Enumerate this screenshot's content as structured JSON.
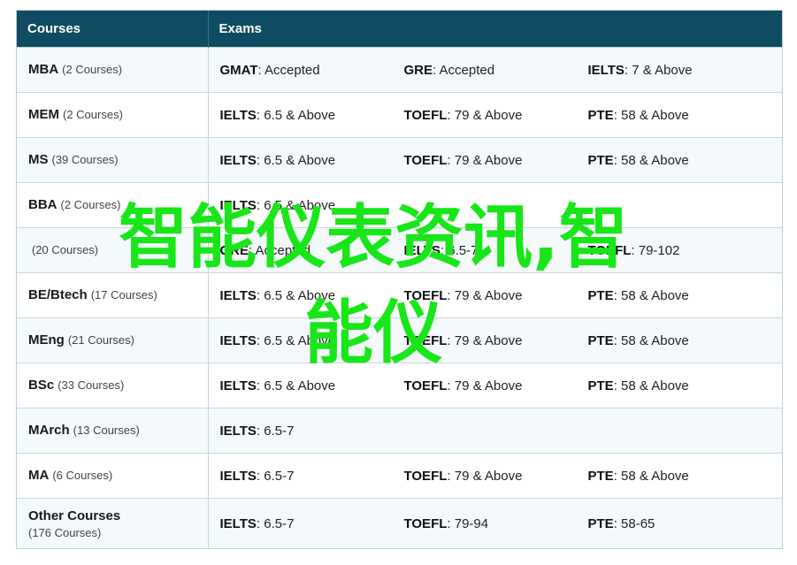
{
  "header": {
    "courses": "Courses",
    "exams": "Exams"
  },
  "rows": [
    {
      "name": "MBA",
      "count": "(2 Courses)",
      "exams": [
        {
          "name": "GMAT",
          "value": ": Accepted"
        },
        {
          "name": "GRE",
          "value": ": Accepted"
        },
        {
          "name": "IELTS",
          "value": ": 7 & Above"
        }
      ]
    },
    {
      "name": "MEM",
      "count": "(2 Courses)",
      "exams": [
        {
          "name": "IELTS",
          "value": ": 6.5 & Above"
        },
        {
          "name": "TOEFL",
          "value": ": 79 & Above"
        },
        {
          "name": "PTE",
          "value": ": 58 & Above"
        }
      ]
    },
    {
      "name": "MS",
      "count": "(39 Courses)",
      "exams": [
        {
          "name": "IELTS",
          "value": ": 6.5 & Above"
        },
        {
          "name": "TOEFL",
          "value": ": 79 & Above"
        },
        {
          "name": "PTE",
          "value": ": 58 & Above"
        }
      ]
    },
    {
      "name": "BBA",
      "count": "(2 Courses)",
      "exams": [
        {
          "name": "IELTS",
          "value": ": 6.5 & Above"
        },
        {
          "name": "",
          "value": ""
        },
        {
          "name": "",
          "value": ""
        }
      ]
    },
    {
      "name": "",
      "count": "(20 Courses)",
      "exams": [
        {
          "name": "GRE",
          "value": ": Accepted"
        },
        {
          "name": "IELTS",
          "value": ": 6.5-7"
        },
        {
          "name": "TOEFL",
          "value": ": 79-102"
        }
      ]
    },
    {
      "name": "BE/Btech",
      "count": "(17 Courses)",
      "exams": [
        {
          "name": "IELTS",
          "value": ": 6.5 & Above"
        },
        {
          "name": "TOEFL",
          "value": ": 79 & Above"
        },
        {
          "name": "PTE",
          "value": ": 58 & Above"
        }
      ]
    },
    {
      "name": "MEng",
      "count": "(21 Courses)",
      "exams": [
        {
          "name": "IELTS",
          "value": ": 6.5 & Above"
        },
        {
          "name": "TOEFL",
          "value": ": 79 & Above"
        },
        {
          "name": "PTE",
          "value": ": 58 & Above"
        }
      ]
    },
    {
      "name": "BSc",
      "count": "(33 Courses)",
      "exams": [
        {
          "name": "IELTS",
          "value": ": 6.5 & Above"
        },
        {
          "name": "TOEFL",
          "value": ": 79 & Above"
        },
        {
          "name": "PTE",
          "value": ": 58 & Above"
        }
      ]
    },
    {
      "name": "MArch",
      "count": "(13 Courses)",
      "exams": [
        {
          "name": "IELTS",
          "value": ": 6.5-7"
        },
        {
          "name": "",
          "value": ""
        },
        {
          "name": "",
          "value": ""
        }
      ]
    },
    {
      "name": "MA",
      "count": "(6 Courses)",
      "exams": [
        {
          "name": "IELTS",
          "value": ": 6.5-7"
        },
        {
          "name": "TOEFL",
          "value": ": 79 & Above"
        },
        {
          "name": "PTE",
          "value": ": 58 & Above"
        }
      ]
    },
    {
      "name": "Other Courses",
      "count": "(176 Courses)",
      "exams": [
        {
          "name": "IELTS",
          "value": ": 6.5-7"
        },
        {
          "name": "TOEFL",
          "value": ": 79-94"
        },
        {
          "name": "PTE",
          "value": ": 58-65"
        }
      ]
    }
  ],
  "watermark": {
    "line1": "智能仪表资讯,智",
    "line2": "能仪"
  }
}
